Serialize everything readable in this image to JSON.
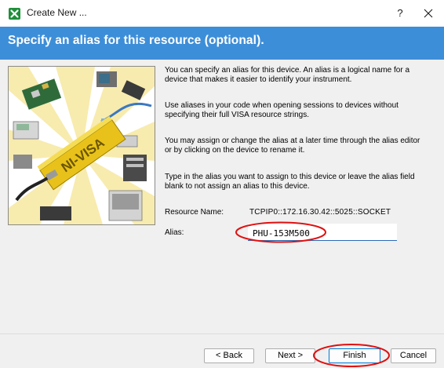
{
  "window": {
    "title": "Create New ...",
    "help_label": "?",
    "accent_color": "#3d8ed8",
    "annotation_color": "#e01010"
  },
  "banner": {
    "title": "Specify an alias for this resource (optional)."
  },
  "illustration": {
    "logo_text": "NI-VISA"
  },
  "description": [
    "You can specify an alias for this device. An alias is a logical name for a device that makes it easier to identify your instrument.",
    "Use aliases in your code when opening sessions to devices without specifying their full VISA resource strings.",
    "You may assign or change the alias at a later time through the alias editor or by clicking on the device to rename it.",
    "Type in the alias you want to assign to this device or leave the alias field blank to not assign an alias to this device."
  ],
  "resource": {
    "label": "Resource Name:",
    "value": "TCPIP0::172.16.30.42::5025::SOCKET"
  },
  "alias": {
    "label": "Alias:",
    "value": "PHU-153M500"
  },
  "buttons": {
    "back": "< Back",
    "next": "Next >",
    "finish": "Finish",
    "cancel": "Cancel"
  }
}
